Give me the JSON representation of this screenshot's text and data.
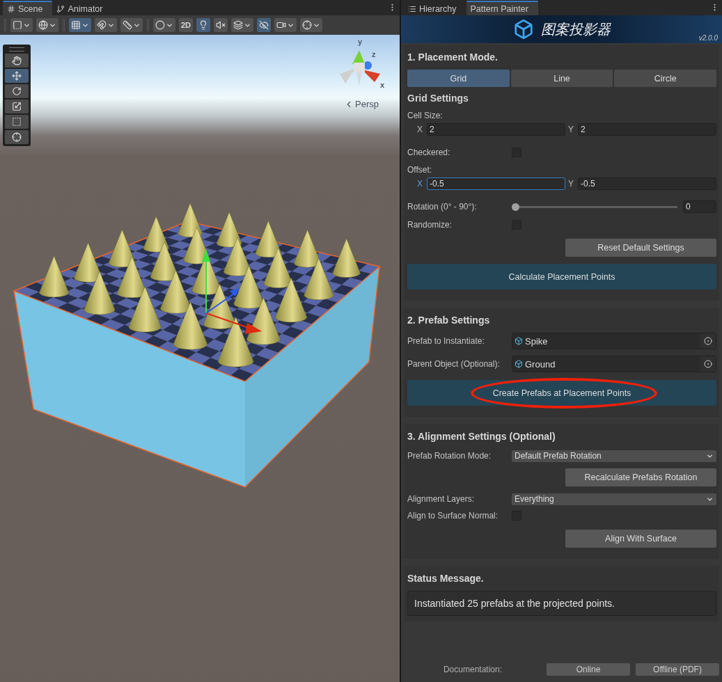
{
  "scene_view": {
    "tabs": [
      {
        "label": "Scene",
        "selected": true
      },
      {
        "label": "Animator",
        "selected": false
      }
    ],
    "toolbar": [
      [
        {
          "dropdown": true,
          "selected": false
        },
        {
          "dropdown": true,
          "selected": false
        }
      ],
      [
        {
          "dropdown": true,
          "selected": true
        },
        {
          "dropdown": true,
          "selected": false
        },
        {
          "dropdown": true,
          "selected": false
        }
      ],
      [
        {
          "dropdown": true,
          "selected": false
        },
        {
          "label": "2D",
          "dropdown": false,
          "selected": false
        },
        {
          "dropdown": false,
          "selected": true
        },
        {
          "dropdown": false,
          "selected": false
        },
        {
          "dropdown": true,
          "selected": false
        },
        {
          "dropdown": false,
          "selected": true
        },
        {
          "dropdown": true,
          "selected": false
        },
        {
          "dropdown": true,
          "selected": false
        }
      ]
    ],
    "tools": [
      {
        "selected": false
      },
      {
        "selected": true
      },
      {
        "selected": false
      },
      {
        "selected": false
      },
      {
        "selected": false
      },
      {
        "selected": false
      }
    ],
    "gizmo": {
      "axes": [
        "y",
        "z",
        "x"
      ],
      "projection": "Persp"
    }
  },
  "inspector": {
    "tabs": [
      {
        "label": "Hierarchy",
        "selected": false
      },
      {
        "label": "Pattern Painter",
        "selected": true
      }
    ],
    "header": {
      "title": "图案投影器",
      "version": "v2.0.0"
    },
    "sections": [
      {
        "title": "1. Placement Mode.",
        "modes": [
          {
            "label": "Grid",
            "selected": true
          },
          {
            "label": "Line",
            "selected": false
          },
          {
            "label": "Circle",
            "selected": false
          }
        ],
        "subtitle": "Grid Settings",
        "rows": [
          {
            "kind": "heading",
            "label": "Cell Size:"
          },
          {
            "kind": "vector",
            "fields": [
              {
                "axis": "X",
                "value": "2",
                "focused": false
              },
              {
                "axis": "Y",
                "value": "2",
                "focused": false
              }
            ]
          },
          {
            "kind": "checkbox",
            "label": "Checkered:",
            "checked": false
          },
          {
            "kind": "heading",
            "label": "Offset:"
          },
          {
            "kind": "vector",
            "fields": [
              {
                "axis": "X",
                "value": "-0.5",
                "focused": true
              },
              {
                "axis": "Y",
                "value": "-0.5",
                "focused": false
              }
            ]
          },
          {
            "kind": "slider",
            "label": "Rotation (0° - 90°):",
            "level": 0,
            "value": "0"
          },
          {
            "kind": "checkbox",
            "label": "Randomize:",
            "checked": false
          },
          {
            "kind": "button",
            "label": "Reset Default Settings",
            "primary": false,
            "highlighted": false
          },
          {
            "kind": "button",
            "label": "Calculate Placement Points",
            "primary": true,
            "highlighted": false
          }
        ]
      },
      {
        "title": "2. Prefab Settings",
        "rows": [
          {
            "kind": "object",
            "label": "Prefab to Instantiate:",
            "value": "Spike"
          },
          {
            "kind": "object",
            "label": "Parent Object (Optional):",
            "value": "Ground"
          },
          {
            "kind": "button",
            "label": "Create Prefabs at Placement Points",
            "primary": true,
            "highlighted": true
          }
        ]
      },
      {
        "title": "3. Alignment Settings (Optional)",
        "rows": [
          {
            "kind": "dropdown",
            "label": "Prefab Rotation Mode:",
            "value": "Default Prefab Rotation"
          },
          {
            "kind": "button",
            "label": "Recalculate Prefabs Rotation",
            "primary": false,
            "highlighted": false
          },
          {
            "kind": "dropdown",
            "label": "Alignment Layers:",
            "value": "Everything"
          },
          {
            "kind": "checkbox",
            "label": "Align to Surface Normal:",
            "checked": false
          },
          {
            "kind": "button",
            "label": "Align With Surface",
            "primary": false,
            "highlighted": false
          }
        ]
      },
      {
        "title": "Status Message.",
        "rows": [
          {
            "kind": "message",
            "text": "Instantiated 25 prefabs at the projected points."
          }
        ]
      }
    ],
    "footer": {
      "label": "Documentation:",
      "buttons": [
        "Online",
        "Offline (PDF)"
      ]
    }
  }
}
